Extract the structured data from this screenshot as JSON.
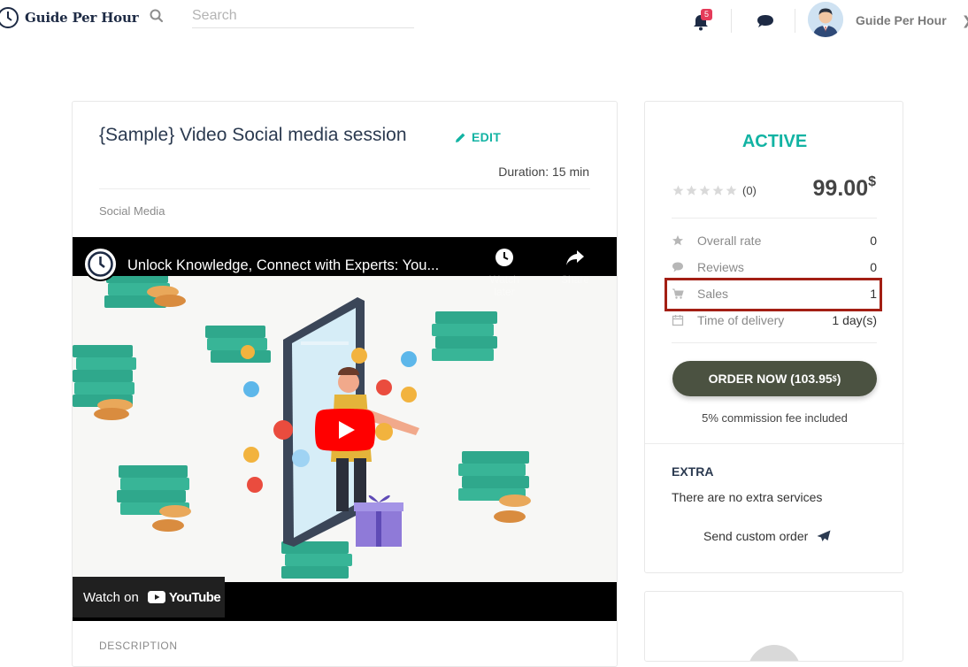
{
  "header": {
    "brand": "Guide Per Hour",
    "search_placeholder": "Search",
    "notifications_count": "5",
    "user_name": "Guide Per Hour"
  },
  "service": {
    "title": "{Sample} Video Social media session",
    "edit_label": "EDIT",
    "duration": "Duration: 15 min",
    "category": "Social Media",
    "description_label": "DESCRIPTION"
  },
  "video": {
    "title": "Unlock Knowledge, Connect with Experts: You...",
    "watch_later": "Watch later",
    "share": "Share",
    "watch_on": "Watch on",
    "youtube": "YouTube"
  },
  "sidebar": {
    "status": "ACTIVE",
    "rating_count": "(0)",
    "price": "99.00",
    "currency": "$",
    "stats": [
      {
        "label": "Overall rate",
        "value": "0",
        "icon": "star-icon"
      },
      {
        "label": "Reviews",
        "value": "0",
        "icon": "comment-icon"
      },
      {
        "label": "Sales",
        "value": "1",
        "icon": "cart-icon"
      },
      {
        "label": "Time of delivery",
        "value": "1 day(s)",
        "icon": "calendar-icon"
      }
    ],
    "order_label": "ORDER NOW (103.95",
    "order_currency": "$",
    "order_suffix": ")",
    "commission": "5% commission fee included",
    "extra_title": "EXTRA",
    "extra_text": "There are no extra services",
    "custom_order": "Send custom order"
  },
  "colors": {
    "accent": "#12b3a3",
    "button": "#4b5241",
    "highlight": "#a31f14",
    "badge": "#e53b5a"
  }
}
